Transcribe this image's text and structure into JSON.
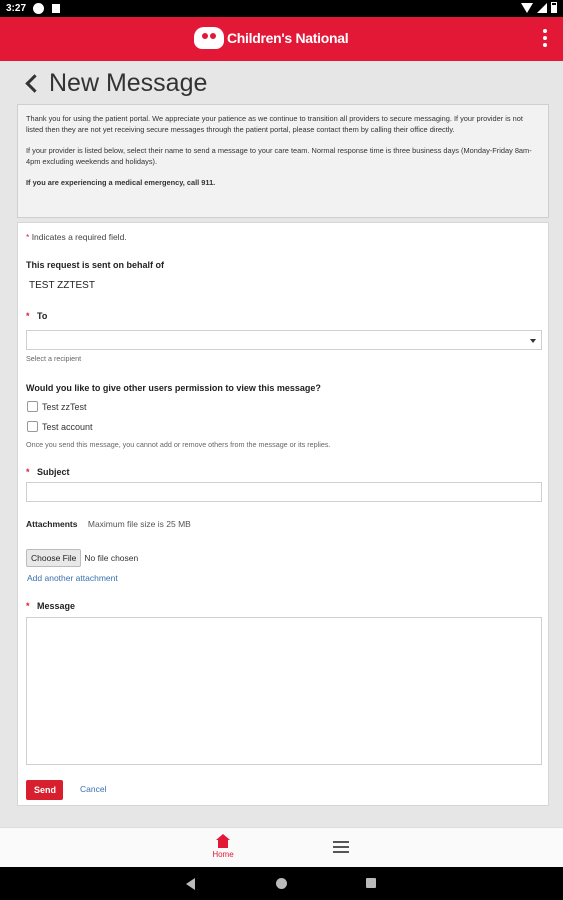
{
  "status_bar": {
    "time": "3:27"
  },
  "app_bar": {
    "logo_text": "Children's National",
    "menu_icon": "more-vert-icon"
  },
  "page": {
    "title": "New Message",
    "back_icon": "chevron-left-icon"
  },
  "info": {
    "paragraph1": "Thank you for using the patient portal.  We appreciate your patience as we continue to transition all providers to secure messaging. If your provider is not listed then they are not yet receiving secure messages through the patient portal, please contact them by calling their office directly.",
    "paragraph2": "If your provider is listed below, select their name to send a message to your care team. Normal response time is three business days (Monday-Friday 8am-4pm excluding weekends and holidays).",
    "paragraph3": "If you are experiencing a medical emergency, call 911."
  },
  "form": {
    "required_star": "*",
    "required_note": "Indicates a required field.",
    "behalf_label": "This request is sent on behalf of",
    "behalf_value": "TEST ZZTEST",
    "to_label": "To",
    "to_hint": "Select a recipient",
    "permission_label": "Would you like to give other users permission to view this message?",
    "permission_options": [
      "Test zzTest",
      "Test account"
    ],
    "permission_note": "Once you send this message, you cannot add or remove others from the message or its replies.",
    "subject_label": "Subject",
    "subject_value": "",
    "attachments_label": "Attachments",
    "attachments_note": "Maximum file size is 25 MB",
    "choose_file": "Choose File",
    "no_file": "No file chosen",
    "add_attachment": "Add another attachment",
    "message_label": "Message",
    "message_value": "",
    "send": "Send",
    "cancel": "Cancel"
  },
  "bottom_nav": {
    "home_label": "Home",
    "home_icon": "home-icon",
    "menu_icon": "hamburger-icon"
  },
  "colors": {
    "brand_red": "#e31837",
    "link_blue": "#3a6fb0"
  }
}
